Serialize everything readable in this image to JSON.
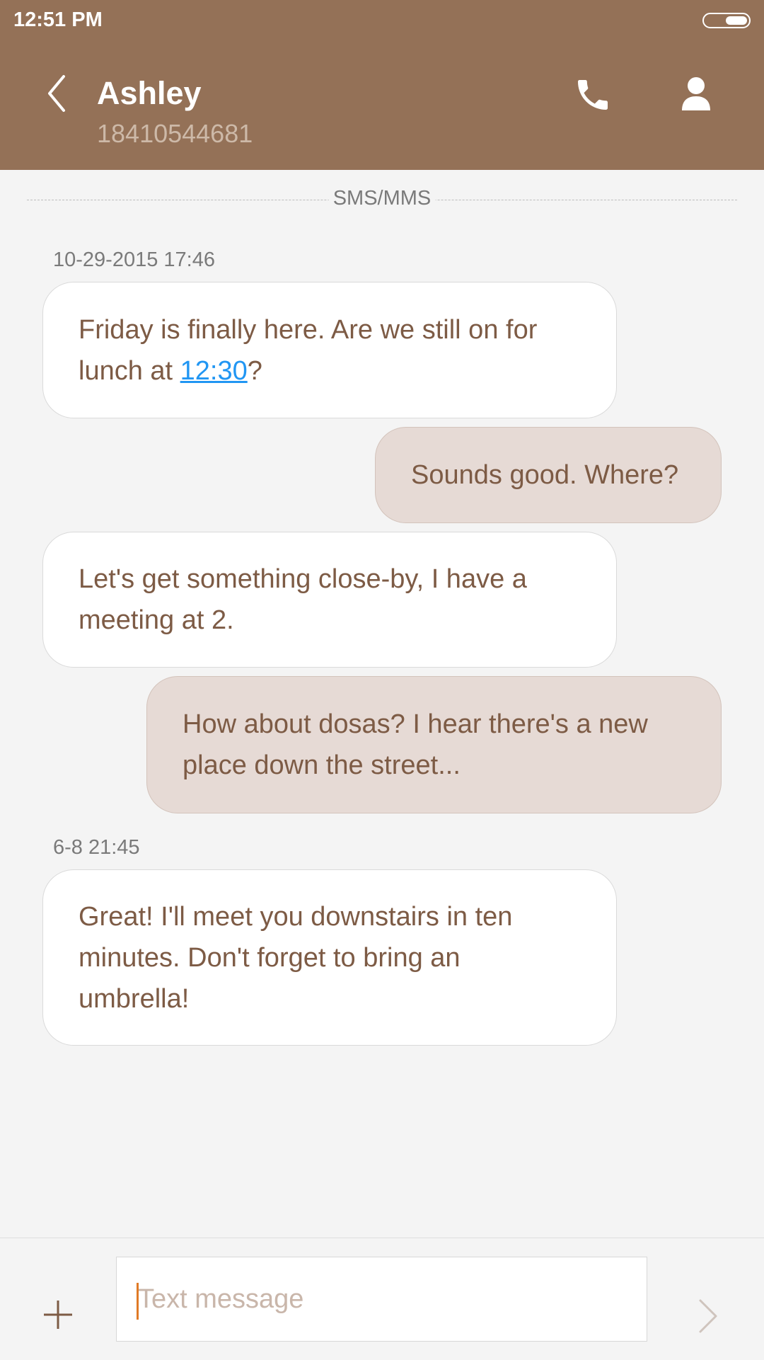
{
  "status_bar": {
    "time": "12:51 PM",
    "icons": [
      "battery-icon"
    ]
  },
  "header": {
    "contact_name": "Ashley",
    "contact_number": "18410544681",
    "icons": [
      "back-arrow-icon",
      "phone-icon",
      "person-icon"
    ]
  },
  "conversation": {
    "channel_label": "SMS/MMS",
    "timestamps": [
      "10-29-2015 17:46",
      "6-8 21:45"
    ],
    "messages": [
      {
        "direction": "incoming",
        "text_before_link": "Friday is finally here. Are we still on for lunch at ",
        "link": "12:30",
        "text_after_link": "?"
      },
      {
        "direction": "outgoing",
        "text": "Sounds good. Where?"
      },
      {
        "direction": "incoming",
        "text": "Let's get something close-by, I have a meeting at 2."
      },
      {
        "direction": "outgoing",
        "text": "How about dosas? I hear there's a new place down the street..."
      },
      {
        "direction": "incoming",
        "text": "Great! I'll meet you downstairs in ten minutes. Don't forget to bring an umbrella!"
      }
    ]
  },
  "compose": {
    "placeholder": "Text message",
    "value": "",
    "icons": [
      "plus-icon",
      "send-chevron-icon"
    ]
  },
  "colors": {
    "header_bg": "#947157",
    "incoming_bubble": "#ffffff",
    "outgoing_bubble": "#e6dad5",
    "message_text": "#7d5b45",
    "link": "#2196f3",
    "caret": "#e07a26"
  }
}
